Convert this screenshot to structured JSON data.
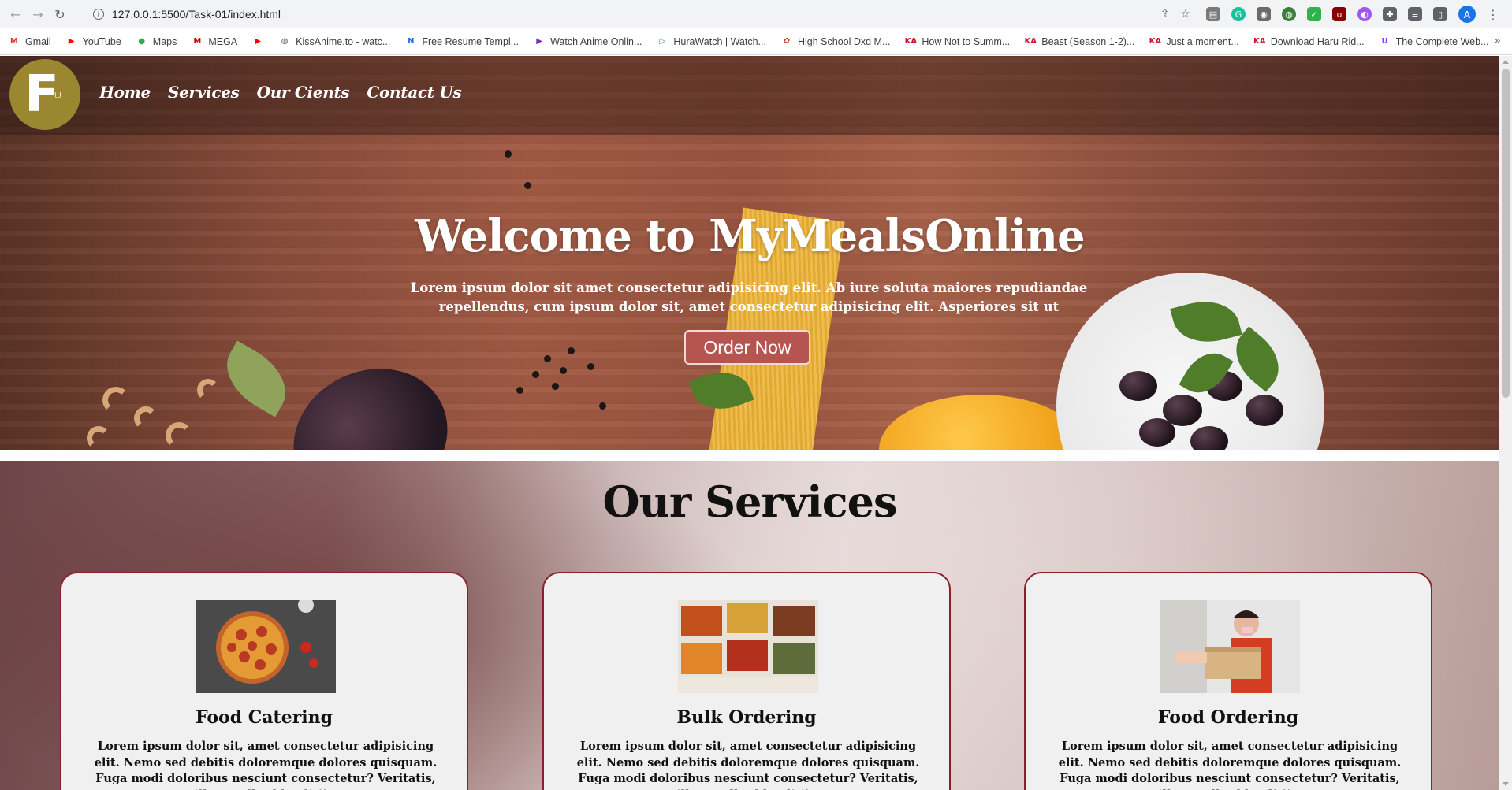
{
  "browser": {
    "url": "127.0.0.1:5500/Task-01/index.html",
    "avatar_letter": "A",
    "bookmarks": [
      {
        "label": "Gmail",
        "icon": "gmail-icon",
        "glyph": "M",
        "color": "#d93025"
      },
      {
        "label": "YouTube",
        "icon": "youtube-icon",
        "glyph": "▶",
        "color": "#ff0000"
      },
      {
        "label": "Maps",
        "icon": "maps-icon",
        "glyph": "●",
        "color": "#34a853"
      },
      {
        "label": "MEGA",
        "icon": "mega-icon",
        "glyph": "M",
        "color": "#d90007"
      },
      {
        "label": "",
        "icon": "youtube-icon",
        "glyph": "▶",
        "color": "#ff0000"
      },
      {
        "label": "KissAnime.to - watc...",
        "icon": "globe-icon",
        "glyph": "◍",
        "color": "#5f6368"
      },
      {
        "label": "Free Resume Templ...",
        "icon": "resume-icon",
        "glyph": "N",
        "color": "#1f6fd1"
      },
      {
        "label": "Watch Anime Onlin...",
        "icon": "play-icon",
        "glyph": "▶",
        "color": "#7b2fbe"
      },
      {
        "label": "HuraWatch | Watch...",
        "icon": "play-icon",
        "glyph": "▷",
        "color": "#2e9e3e"
      },
      {
        "label": "High School Dxd M...",
        "icon": "anime-icon",
        "glyph": "✿",
        "color": "#c0392b"
      },
      {
        "label": "How Not to Summ...",
        "icon": "ka-icon",
        "glyph": "KA",
        "color": "#d10f2f"
      },
      {
        "label": "Beast (Season 1-2)...",
        "icon": "ka-icon",
        "glyph": "KA",
        "color": "#d10f2f"
      },
      {
        "label": "Just a moment...",
        "icon": "ka-icon",
        "glyph": "KA",
        "color": "#d10f2f"
      },
      {
        "label": "Download Haru Rid...",
        "icon": "ka-icon",
        "glyph": "KA",
        "color": "#d10f2f"
      },
      {
        "label": "The Complete Web...",
        "icon": "course-icon",
        "glyph": "U",
        "color": "#8a3ffc"
      }
    ]
  },
  "site": {
    "nav": [
      "Home",
      "Services",
      "Our Cients",
      "Contact Us"
    ],
    "hero": {
      "title": "Welcome to MyMealsOnline",
      "subtitle": "Lorem ipsum dolor sit amet consectetur adipisicing elit. Ab iure soluta maiores repudiandae repellendus, cum ipsum dolor sit, amet consectetur adipisicing elit. Asperiores sit ut",
      "cta": "Order Now"
    },
    "services": {
      "title": "Our Services",
      "cards": [
        {
          "title": "Food Catering",
          "text": "Lorem ipsum dolor sit, amet consectetur adipisicing elit. Nemo sed debitis doloremque dolores quisquam. Fuga modi doloribus nesciunt consectetur? Veritatis, illo repellat blanditiis,",
          "image": "pizza"
        },
        {
          "title": "Bulk Ordering",
          "text": "Lorem ipsum dolor sit, amet consectetur adipisicing elit. Nemo sed debitis doloremque dolores quisquam. Fuga modi doloribus nesciunt consectetur? Veritatis, illo repellat blanditiis,",
          "image": "spices"
        },
        {
          "title": "Food Ordering",
          "text": "Lorem ipsum dolor sit, amet consectetur adipisicing elit. Nemo sed debitis doloremque dolores quisquam. Fuga modi doloribus nesciunt consectetur? Veritatis, illo repellat blanditiis,",
          "image": "delivery"
        }
      ]
    },
    "colors": {
      "logo": "#9c8731",
      "cta": "#b65450",
      "card_border": "#8c1f2a"
    }
  }
}
